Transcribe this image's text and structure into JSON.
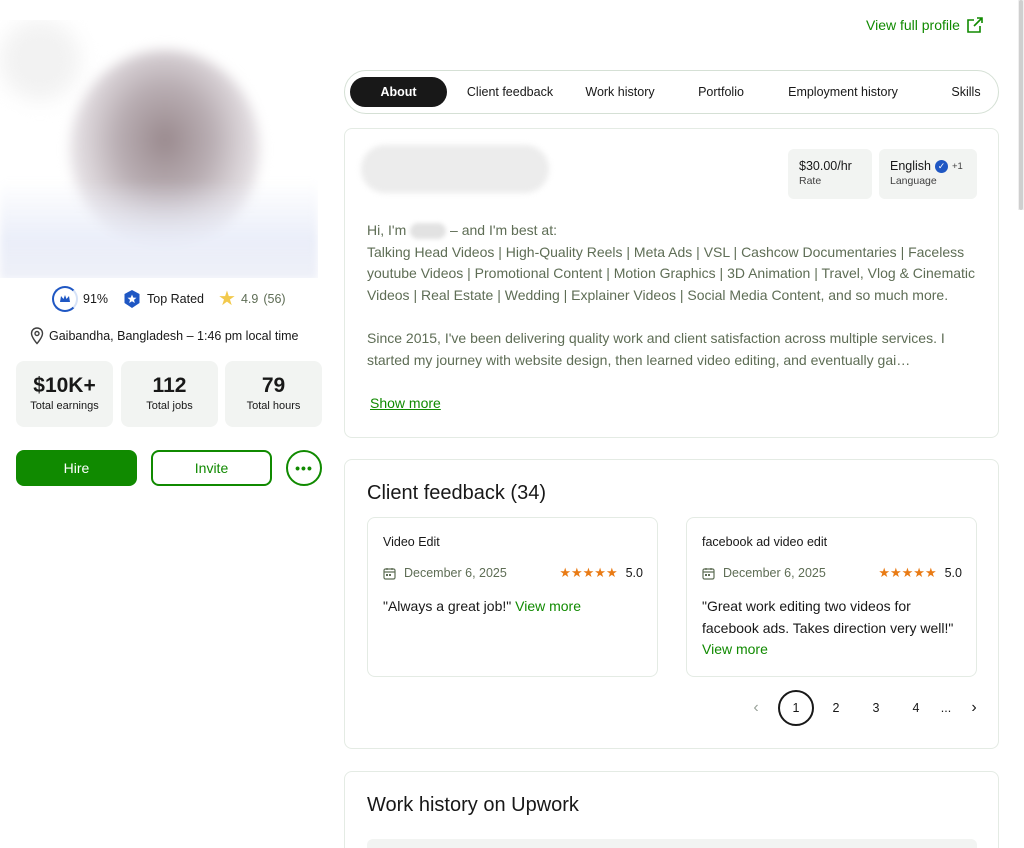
{
  "profile": {
    "job_success": "91%",
    "badge": "Top Rated",
    "rating": "4.9",
    "rating_count": "(56)",
    "location": "Gaibandha, Bangladesh – 1:46 pm local time",
    "stats": [
      {
        "value": "$10K+",
        "label": "Total earnings"
      },
      {
        "value": "112",
        "label": "Total jobs"
      },
      {
        "value": "79",
        "label": "Total hours"
      }
    ],
    "hire_label": "Hire",
    "invite_label": "Invite",
    "more_label": "•••"
  },
  "header": {
    "view_full_profile": "View full profile"
  },
  "tabs": [
    "About",
    "Client feedback",
    "Work history",
    "Portfolio",
    "Employment history",
    "Skills"
  ],
  "about": {
    "rate": "$30.00/hr",
    "rate_label": "Rate",
    "language": "English",
    "language_extra": "+1",
    "language_label": "Language",
    "intro_prefix": "Hi, I'm",
    "intro_suffix": "– and I'm best at:",
    "specialties": "Talking Head Videos | High-Quality Reels | Meta Ads | VSL | Cashcow Documentaries | Faceless youtube Videos | Promotional Content | Motion Graphics | 3D Animation | Travel, Vlog & Cinematic Videos | Real Estate | Wedding | Explainer Videos | Social Media Content, and so much more.",
    "paragraph2": "Since 2015, I've been delivering quality work and client satisfaction across multiple services. I started my journey with website design, then learned video editing, and eventually gai…",
    "show_more": "Show more"
  },
  "client_feedback": {
    "title": "Client feedback (34)",
    "items": [
      {
        "title": "Video Edit",
        "date": "December 6, 2025",
        "stars": "★★★★★",
        "score": "5.0",
        "quote": "\"Always a great job!\"",
        "view_more": "View more"
      },
      {
        "title": "facebook ad video edit",
        "date": "December 6, 2025",
        "stars": "★★★★★",
        "score": "5.0",
        "quote": "\"Great work editing two videos for facebook ads. Takes direction very well!\"",
        "view_more": "View more"
      }
    ],
    "pages": [
      "1",
      "2",
      "3",
      "4"
    ],
    "ellipsis": "..."
  },
  "work_history": {
    "title": "Work history on Upwork"
  },
  "colors": {
    "brand_green": "#108a00",
    "star_orange": "#e97b15",
    "badge_blue": "#1f57c3"
  }
}
